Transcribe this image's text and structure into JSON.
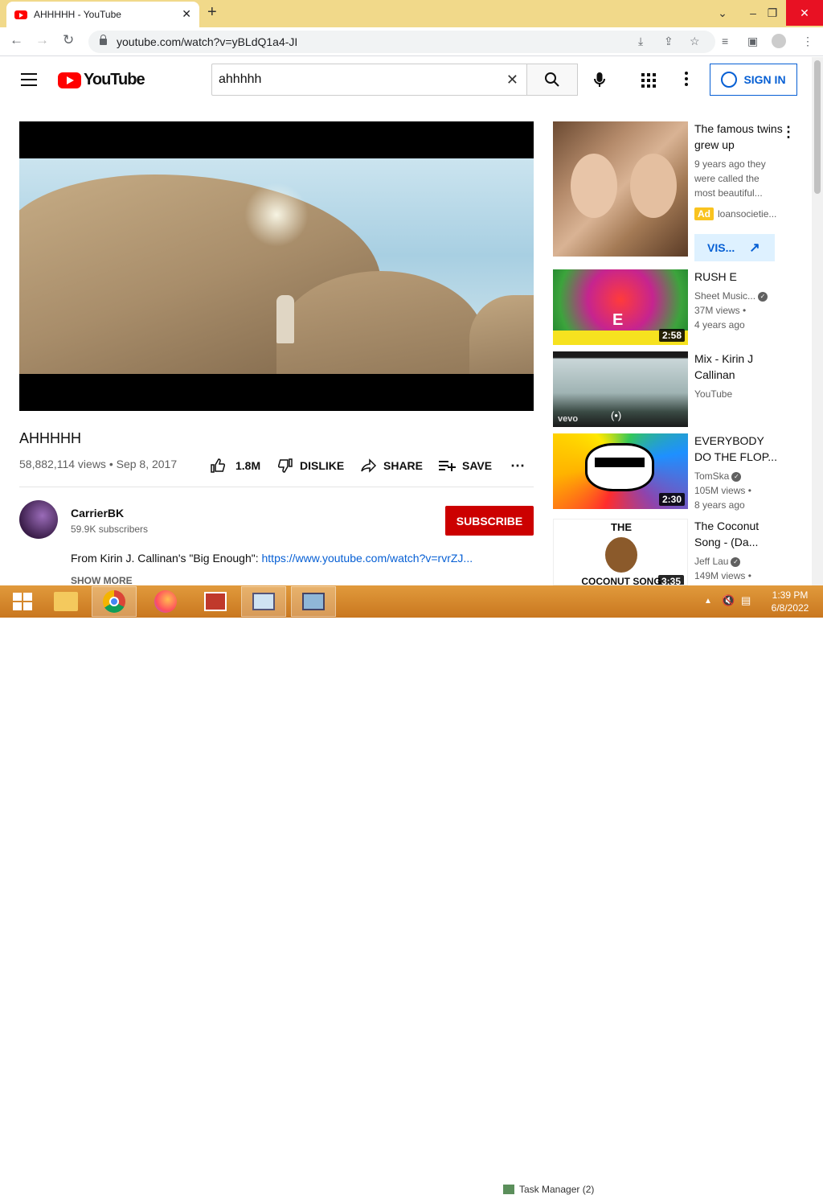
{
  "browser": {
    "tab_title": "AHHHHH - YouTube",
    "url": "youtube.com/watch?v=yBLdQ1a4-JI"
  },
  "header": {
    "logo_text": "YouTube",
    "search_value": "ahhhhh",
    "sign_in_label": "SIGN IN"
  },
  "video": {
    "title": "AHHHHH",
    "meta": "58,882,114 views • Sep 8, 2017",
    "likes": "1.8M",
    "dislike_label": "DISLIKE",
    "share_label": "SHARE",
    "save_label": "SAVE"
  },
  "channel": {
    "name": "CarrierBK",
    "subscribers": "59.9K subscribers",
    "subscribe_label": "SUBSCRIBE"
  },
  "description": {
    "text": "From Kirin J. Callinan's \"Big Enough\": ",
    "link": "https://www.youtube.com/watch?v=rvrZJ...",
    "show_more": "SHOW MORE"
  },
  "sidebar": {
    "ad": {
      "title": "The famous twins grew up",
      "desc": "9 years ago they were called the most beautiful...",
      "badge": "Ad",
      "advertiser": "loansocietie...",
      "visit_label": "VIS..."
    },
    "items": [
      {
        "title": "RUSH E",
        "channel": "Sheet Music...",
        "views": "37M views •",
        "age": "4 years ago",
        "duration": "2:58"
      },
      {
        "title": "Mix - Kirin J Callinan",
        "channel": "YouTube",
        "views": "",
        "age": "",
        "duration": ""
      },
      {
        "title": "EVERYBODY DO THE FLOP...",
        "channel": "TomSka",
        "views": "105M views •",
        "age": "8 years ago",
        "duration": "2:30"
      },
      {
        "title": "The Coconut Song - (Da...",
        "channel": "Jeff Lau",
        "views": "149M views •",
        "age": "",
        "duration": "3:35"
      }
    ],
    "rush_e_thumb_text": "E",
    "coconut_top": "THE",
    "coconut_bottom": "COCONUT SONG",
    "mix_watermark": "vevo"
  },
  "taskbar": {
    "time": "1:39 PM",
    "date": "6/8/2022",
    "task_manager": "Task Manager (2)"
  },
  "colors": {
    "accent": "#065fd4",
    "brand": "#ff0000",
    "subscribe": "#cc0000",
    "taskbar": "#d88a2c"
  }
}
